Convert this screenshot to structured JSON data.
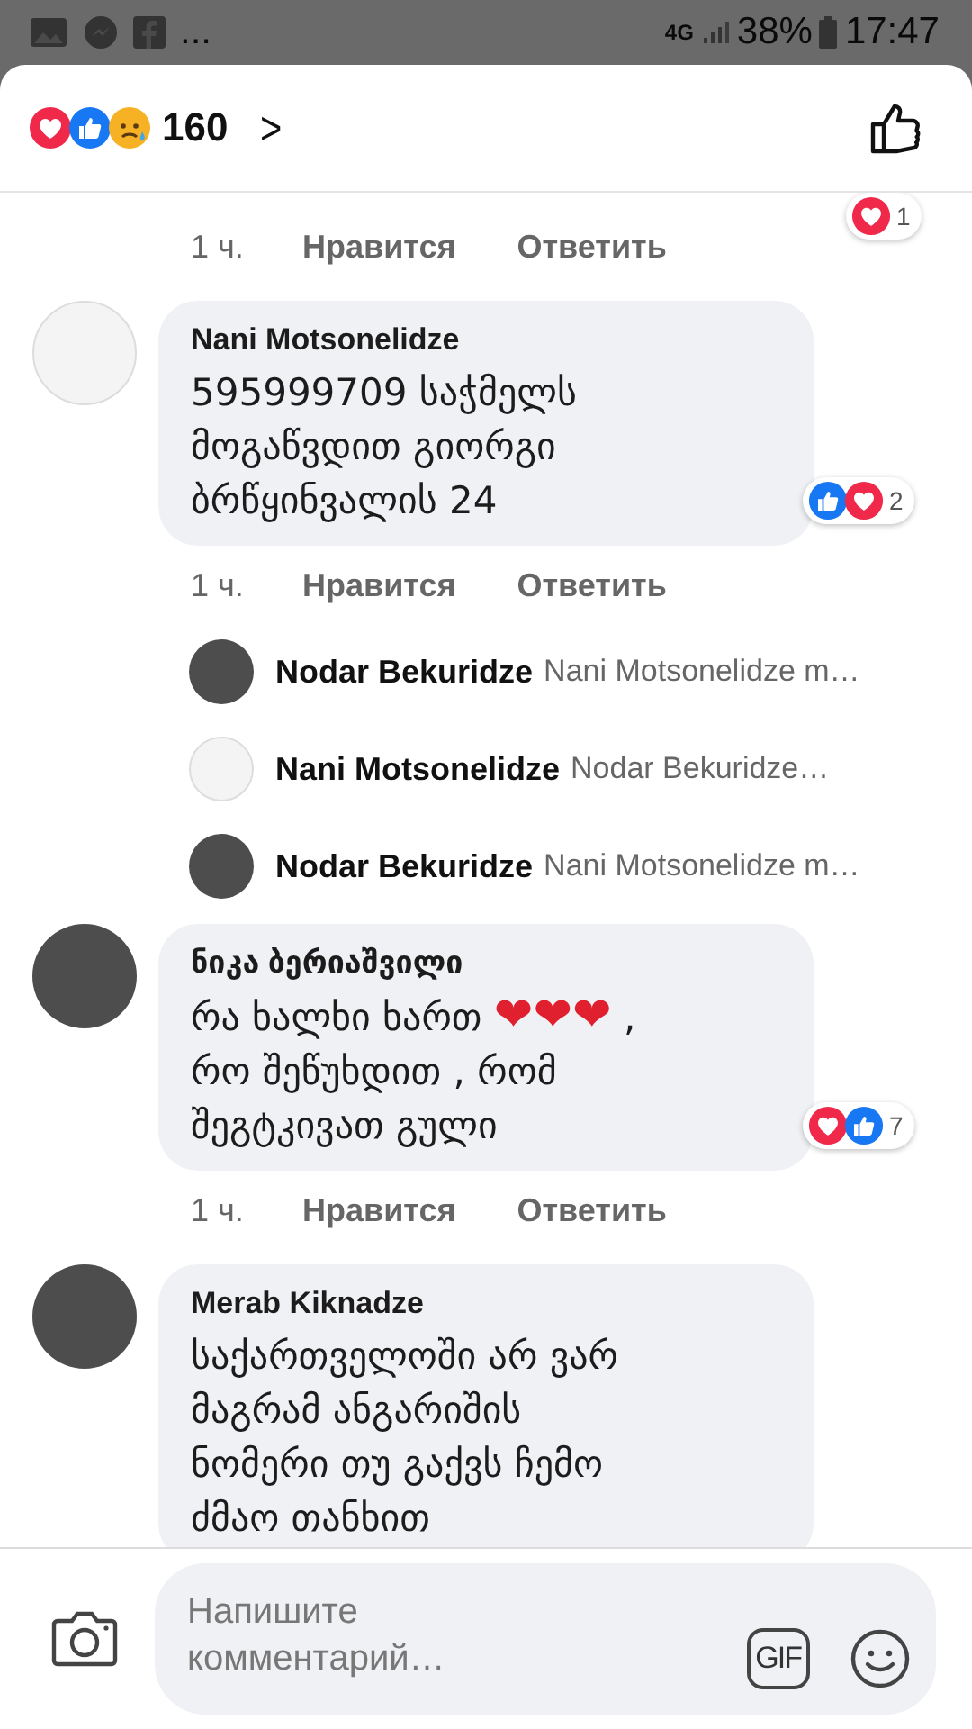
{
  "status_bar": {
    "more": "...",
    "network": "4G",
    "battery": "38%",
    "time": "17:47"
  },
  "header": {
    "reactions": [
      {
        "kind": "love"
      },
      {
        "kind": "like"
      },
      {
        "kind": "sad"
      }
    ],
    "count": "160",
    "chevron": ">"
  },
  "comments": [
    {
      "kind": "partial",
      "time": "1 ч.",
      "like": "Нравится",
      "reply": "Ответить",
      "reactions": {
        "types": [
          {
            "kind": "love"
          }
        ],
        "count": "1"
      }
    },
    {
      "kind": "comment",
      "author": "Nani Motsonelidze",
      "avatar": {
        "kind": "text-image"
      },
      "lines": [
        [
          {
            "kind": "text",
            "text": "595999709 საჭმელს"
          }
        ],
        [
          {
            "kind": "text",
            "text": "მოგაწვდით გიორგი"
          }
        ],
        [
          {
            "kind": "text",
            "text": "ბრწყინვალის 24"
          }
        ]
      ],
      "reactions": {
        "types": [
          {
            "kind": "like"
          },
          {
            "kind": "love"
          }
        ],
        "count": "2"
      },
      "time": "1 ч.",
      "like": "Нравится",
      "reply": "Ответить",
      "replies": [
        {
          "author": "Nodar Bekuridze",
          "avatar": {
            "kind": "photo"
          },
          "preview": "Nani Motsonelidze m…"
        },
        {
          "author": "Nani Motsonelidze",
          "avatar": {
            "kind": "text-image"
          },
          "preview": "Nodar Bekuridze…"
        },
        {
          "author": "Nodar Bekuridze",
          "avatar": {
            "kind": "photo"
          },
          "preview": "Nani Motsonelidze m…"
        }
      ]
    },
    {
      "kind": "comment",
      "author": "ნიკა ბერიაშვილი",
      "avatar": {
        "kind": "photo"
      },
      "lines": [
        [
          {
            "kind": "text",
            "text": "რა ხალხი ხართ "
          },
          {
            "kind": "emoji",
            "text": "❤❤❤"
          },
          {
            "kind": "text",
            "text": " ,"
          }
        ],
        [
          {
            "kind": "text",
            "text": "რო შეწუხდით , რომ"
          }
        ],
        [
          {
            "kind": "text",
            "text": "შეგტკივათ გული"
          }
        ]
      ],
      "reactions": {
        "types": [
          {
            "kind": "love"
          },
          {
            "kind": "like"
          }
        ],
        "count": "7"
      },
      "time": "1 ч.",
      "like": "Нравится",
      "reply": "Ответить"
    },
    {
      "kind": "comment",
      "author": "Merab Kiknadze",
      "avatar": {
        "kind": "photo"
      },
      "lines": [
        [
          {
            "kind": "text",
            "text": "საქართველოში არ ვარ"
          }
        ],
        [
          {
            "kind": "text",
            "text": "მაგრამ ანგარიშის"
          }
        ],
        [
          {
            "kind": "text",
            "text": "ნომერი თუ გაქვს ჩემო"
          }
        ],
        [
          {
            "kind": "text",
            "text": "ძმაო თანხით"
          }
        ]
      ]
    }
  ],
  "composer": {
    "placeholder": "Напишите комментарий…",
    "gif": "GIF"
  }
}
